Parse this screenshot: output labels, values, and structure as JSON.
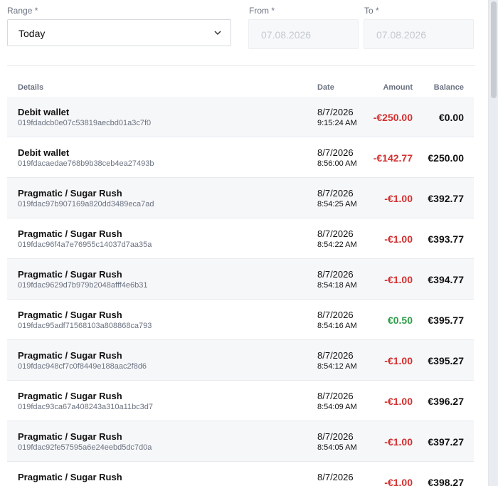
{
  "filters": {
    "range_label": "Range *",
    "range_value": "Today",
    "from_label": "From *",
    "from_value": "07.08.2026",
    "to_label": "To *",
    "to_value": "07.08.2026"
  },
  "table": {
    "headers": {
      "details": "Details",
      "date": "Date",
      "amount": "Amount",
      "balance": "Balance"
    },
    "rows": [
      {
        "title": "Debit wallet",
        "id": "019fdadcb0e07c53819aecbd01a3c7f0",
        "date": "8/7/2026",
        "time": "9:15:24 AM",
        "amount": "-€250.00",
        "sign": "neg",
        "balance": "€0.00"
      },
      {
        "title": "Debit wallet",
        "id": "019fdacaedae768b9b38ceb4ea27493b",
        "date": "8/7/2026",
        "time": "8:56:00 AM",
        "amount": "-€142.77",
        "sign": "neg",
        "balance": "€250.00"
      },
      {
        "title": "Pragmatic / Sugar Rush",
        "id": "019fdac97b907169a820dd3489eca7ad",
        "date": "8/7/2026",
        "time": "8:54:25 AM",
        "amount": "-€1.00",
        "sign": "neg",
        "balance": "€392.77"
      },
      {
        "title": "Pragmatic / Sugar Rush",
        "id": "019fdac96f4a7e76955c14037d7aa35a",
        "date": "8/7/2026",
        "time": "8:54:22 AM",
        "amount": "-€1.00",
        "sign": "neg",
        "balance": "€393.77"
      },
      {
        "title": "Pragmatic / Sugar Rush",
        "id": "019fdac9629d7b979b2048afff4e6b31",
        "date": "8/7/2026",
        "time": "8:54:18 AM",
        "amount": "-€1.00",
        "sign": "neg",
        "balance": "€394.77"
      },
      {
        "title": "Pragmatic / Sugar Rush",
        "id": "019fdac95adf71568103a808868ca793",
        "date": "8/7/2026",
        "time": "8:54:16 AM",
        "amount": "€0.50",
        "sign": "pos",
        "balance": "€395.77"
      },
      {
        "title": "Pragmatic / Sugar Rush",
        "id": "019fdac948cf7c0f8449e188aac2f8d6",
        "date": "8/7/2026",
        "time": "8:54:12 AM",
        "amount": "-€1.00",
        "sign": "neg",
        "balance": "€395.27"
      },
      {
        "title": "Pragmatic / Sugar Rush",
        "id": "019fdac93ca67a408243a310a11bc3d7",
        "date": "8/7/2026",
        "time": "8:54:09 AM",
        "amount": "-€1.00",
        "sign": "neg",
        "balance": "€396.27"
      },
      {
        "title": "Pragmatic / Sugar Rush",
        "id": "019fdac92fe57595a6e24eebd5dc7d0a",
        "date": "8/7/2026",
        "time": "8:54:05 AM",
        "amount": "-€1.00",
        "sign": "neg",
        "balance": "€397.27"
      },
      {
        "title": "Pragmatic / Sugar Rush",
        "id": "",
        "date": "8/7/2026",
        "time": "",
        "amount": "-€1.00",
        "sign": "neg",
        "balance": "€398.27"
      }
    ]
  },
  "colors": {
    "negative": "#d32f2f",
    "positive": "#2e9d48"
  },
  "icons": {
    "range_dropdown": "chevron-down-icon"
  }
}
